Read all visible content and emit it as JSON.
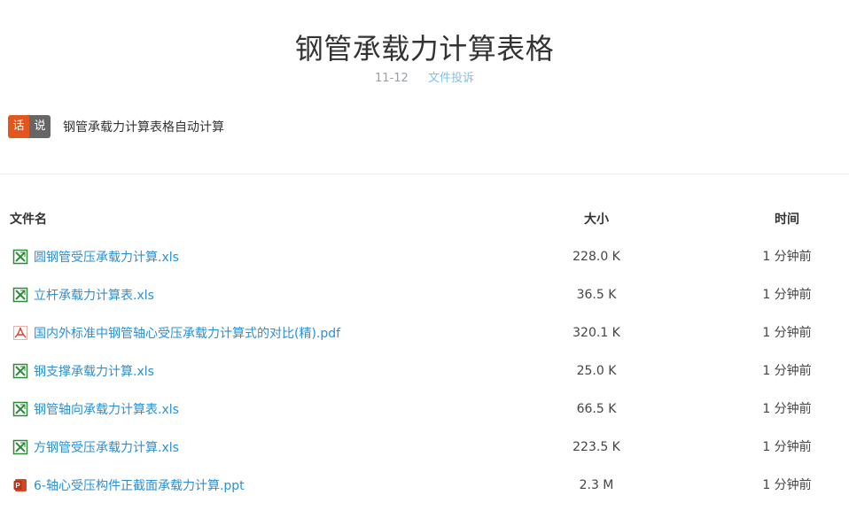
{
  "page": {
    "title": "钢管承载力计算表格",
    "date": "11-12",
    "report_link": "文件投诉"
  },
  "talk": {
    "badge": [
      "话",
      "说"
    ],
    "text": "钢管承载力计算表格自动计算"
  },
  "table": {
    "headers": {
      "name": "文件名",
      "size": "大小",
      "time": "时间"
    },
    "rows": [
      {
        "icon": "excel-icon",
        "name": "圆钢管受压承载力计算.xls",
        "size": "228.0 K",
        "time": "1 分钟前"
      },
      {
        "icon": "excel-icon",
        "name": "立杆承载力计算表.xls",
        "size": "36.5 K",
        "time": "1 分钟前"
      },
      {
        "icon": "pdf-icon",
        "name": "国内外标准中钢管轴心受压承载力计算式的对比(精).pdf",
        "size": "320.1 K",
        "time": "1 分钟前"
      },
      {
        "icon": "excel-icon",
        "name": "钢支撑承载力计算.xls",
        "size": "25.0 K",
        "time": "1 分钟前"
      },
      {
        "icon": "excel-icon",
        "name": "钢管轴向承载力计算表.xls",
        "size": "66.5 K",
        "time": "1 分钟前"
      },
      {
        "icon": "excel-icon",
        "name": "方钢管受压承载力计算.xls",
        "size": "223.5 K",
        "time": "1 分钟前"
      },
      {
        "icon": "powerpoint-icon",
        "name": "6-轴心受压构件正截面承载力计算.ppt",
        "size": "2.3 M",
        "time": "1 分钟前"
      }
    ]
  },
  "colors": {
    "link": "#2b8fd6",
    "badge_left": "#e2571e",
    "badge_right": "#666666",
    "excel": "#2e8b3a",
    "pdf": "#d8402f",
    "ppt": "#d24726"
  }
}
